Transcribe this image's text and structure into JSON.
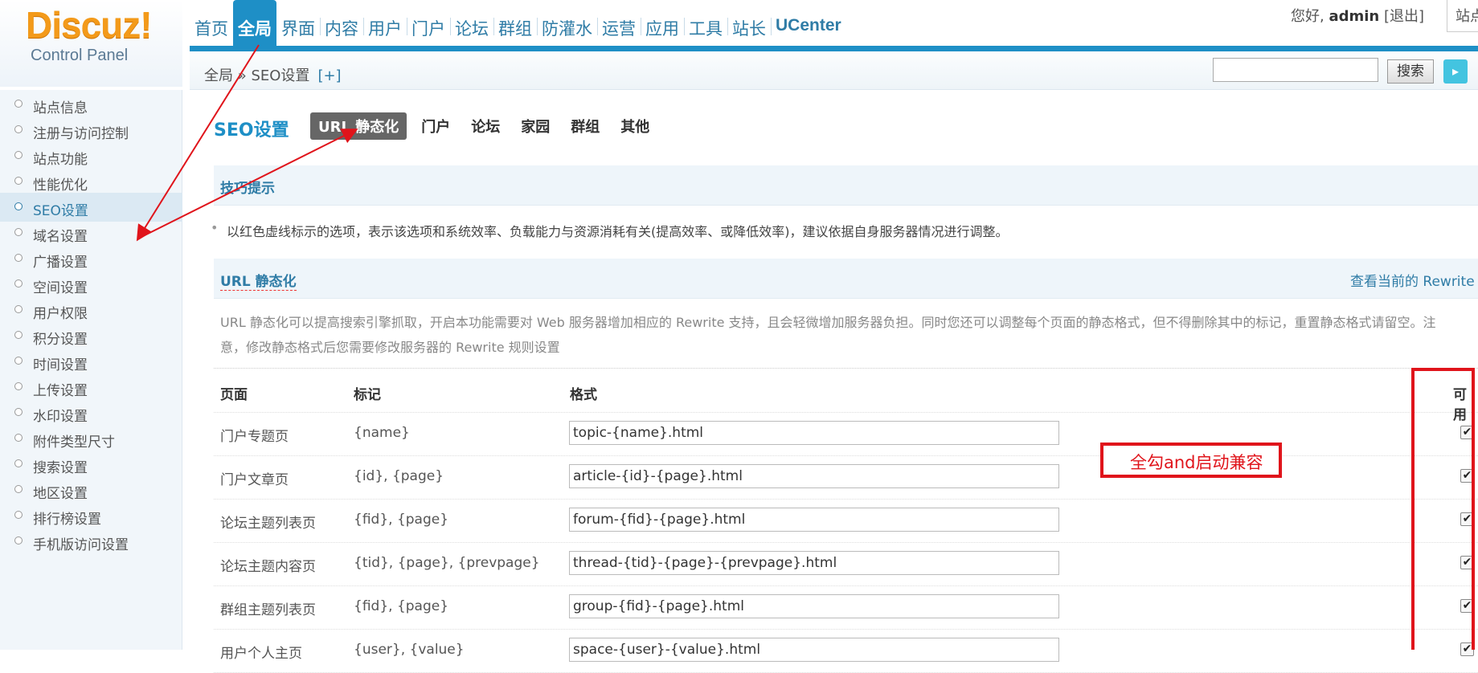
{
  "logo": {
    "title": "Discuz!",
    "subtitle": "Control Panel"
  },
  "topnav": [
    "首页",
    "全局",
    "界面",
    "内容",
    "用户",
    "门户",
    "论坛",
    "群组",
    "防灌水",
    "运营",
    "应用",
    "工具",
    "站长",
    "UCenter"
  ],
  "topnav_active": "全局",
  "user": {
    "greeting": "您好,",
    "name": "admin",
    "logout": "[退出]",
    "site": "站点"
  },
  "breadcrumb": {
    "text": "全局 » SEO设置",
    "plus": "[+]"
  },
  "search": {
    "value": "",
    "button": "搜索"
  },
  "sidebar": [
    "站点信息",
    "注册与访问控制",
    "站点功能",
    "性能优化",
    "SEO设置",
    "域名设置",
    "广播设置",
    "空间设置",
    "用户权限",
    "积分设置",
    "时间设置",
    "上传设置",
    "水印设置",
    "附件类型尺寸",
    "搜索设置",
    "地区设置",
    "排行榜设置",
    "手机版访问设置"
  ],
  "sidebar_active": "SEO设置",
  "page_title": "SEO设置",
  "subtabs": [
    "URL 静态化",
    "门户",
    "论坛",
    "家园",
    "群组",
    "其他"
  ],
  "tips": {
    "title": "技巧提示",
    "line": "以红色虚线标示的选项，表示该选项和系统效率、负载能力与资源消耗有关(提高效率、或降低效率)，建议依据自身服务器情况进行调整。"
  },
  "section": {
    "title": "URL 静态化",
    "link": "查看当前的 Rewrite 规则",
    "desc": "URL 静态化可以提高搜索引擎抓取，开启本功能需要对 Web 服务器增加相应的 Rewrite 支持，且会轻微增加服务器负担。同时您还可以调整每个页面的静态格式，但不得删除其中的标记，重置静态格式请留空。注意，修改静态格式后您需要修改服务器的 Rewrite 规则设置"
  },
  "table": {
    "headers": {
      "page": "页面",
      "mark": "标记",
      "format": "格式",
      "enabled": "可用"
    },
    "rows": [
      {
        "page": "门户专题页",
        "mark": "{name}",
        "format": "topic-{name}.html",
        "checked": "✔"
      },
      {
        "page": "门户文章页",
        "mark": "{id}, {page}",
        "format": "article-{id}-{page}.html",
        "checked": "✔"
      },
      {
        "page": "论坛主题列表页",
        "mark": "{fid}, {page}",
        "format": "forum-{fid}-{page}.html",
        "checked": "✔"
      },
      {
        "page": "论坛主题内容页",
        "mark": "{tid}, {page}, {prevpage}",
        "format": "thread-{tid}-{page}-{prevpage}.html",
        "checked": "✔"
      },
      {
        "page": "群组主题列表页",
        "mark": "{fid}, {page}",
        "format": "group-{fid}-{page}.html",
        "checked": "✔"
      },
      {
        "page": "用户个人主页",
        "mark": "{user}, {value}",
        "format": "space-{user}-{value}.html",
        "checked": "✔"
      }
    ]
  },
  "annotation": {
    "note": "全勾and启动兼容",
    "color": "#e0141b"
  },
  "colors": {
    "accent": "#1e8fc6",
    "link": "#2f7ca6",
    "logo": "#f39a1a"
  }
}
